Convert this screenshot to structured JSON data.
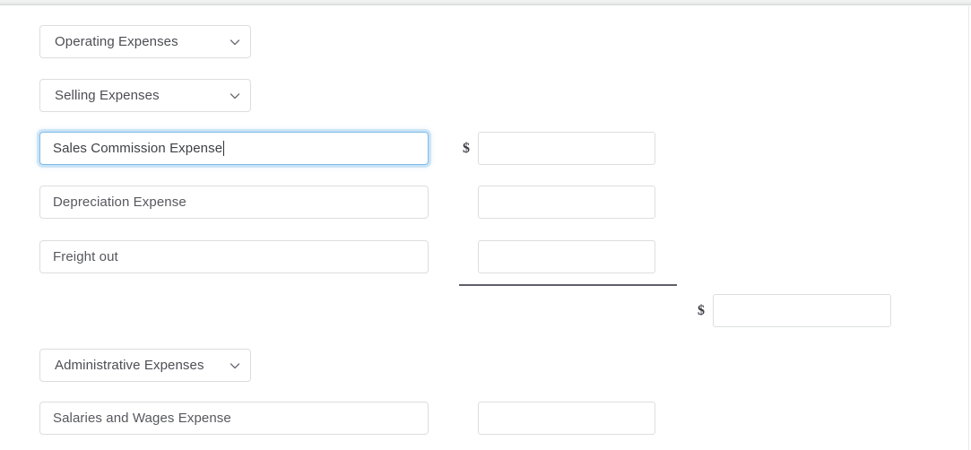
{
  "window": {
    "top_strip": "browser-chrome-strip"
  },
  "icons": {
    "chevron_down": "chevron-down-icon",
    "currency": "$"
  },
  "form": {
    "statement_section_select": {
      "value": "Operating Expenses",
      "options": [
        "Operating Expenses"
      ]
    },
    "subsection_select": {
      "value": "Selling Expenses",
      "options": [
        "Selling Expenses"
      ]
    },
    "selling_rows": [
      {
        "account_name": "Sales Commission Expense",
        "focused": true,
        "currency": "$",
        "amount": "",
        "amount_placeholder": ""
      },
      {
        "account_name": "Depreciation Expense",
        "focused": false,
        "currency": "",
        "amount": "",
        "amount_placeholder": ""
      },
      {
        "account_name": "Freight out",
        "focused": false,
        "currency": "",
        "amount": "",
        "amount_placeholder": ""
      }
    ],
    "selling_subtotal": {
      "currency": "$",
      "amount": "",
      "amount_placeholder": ""
    },
    "admin_select": {
      "value": "Administrative Expenses",
      "options": [
        "Administrative Expenses"
      ]
    },
    "admin_rows": [
      {
        "account_name": "Salaries and Wages Expense",
        "focused": false,
        "currency": "",
        "amount": "",
        "amount_placeholder": ""
      }
    ]
  },
  "colors": {
    "focus_border": "#7fbdea",
    "field_border": "#dcdddf",
    "text": "#4d4e55",
    "rule": "#5f6068",
    "chrome": "#ededee"
  }
}
